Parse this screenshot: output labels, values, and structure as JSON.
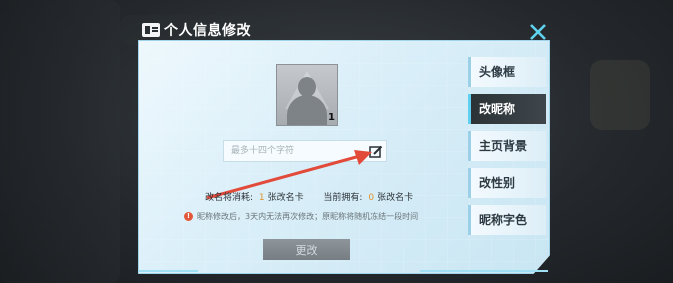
{
  "window": {
    "title": "个人信息修改"
  },
  "avatar": {
    "badge": "1"
  },
  "name_field": {
    "placeholder": "最多十四个字符",
    "value": ""
  },
  "cost": {
    "label": "改名将消耗:",
    "cost_count": "1",
    "cost_unit": "张改名卡",
    "owned_label": "当前拥有:",
    "owned_count": "0",
    "owned_unit": "张改名卡"
  },
  "notice": {
    "icon": "!",
    "text": "昵称修改后，3天内无法再次修改；原昵称将随机冻结一段时间"
  },
  "submit": {
    "label": "更改"
  },
  "tabs": [
    {
      "label": "头像框",
      "active": false
    },
    {
      "label": "改昵称",
      "active": true
    },
    {
      "label": "主页背景",
      "active": false
    },
    {
      "label": "改性别",
      "active": false
    },
    {
      "label": "昵称字色",
      "active": false
    }
  ],
  "colors": {
    "accent": "#e2932a",
    "arrow": "#e24a3a",
    "close": "#5fd3ee",
    "active_tab": "#2c3337"
  }
}
